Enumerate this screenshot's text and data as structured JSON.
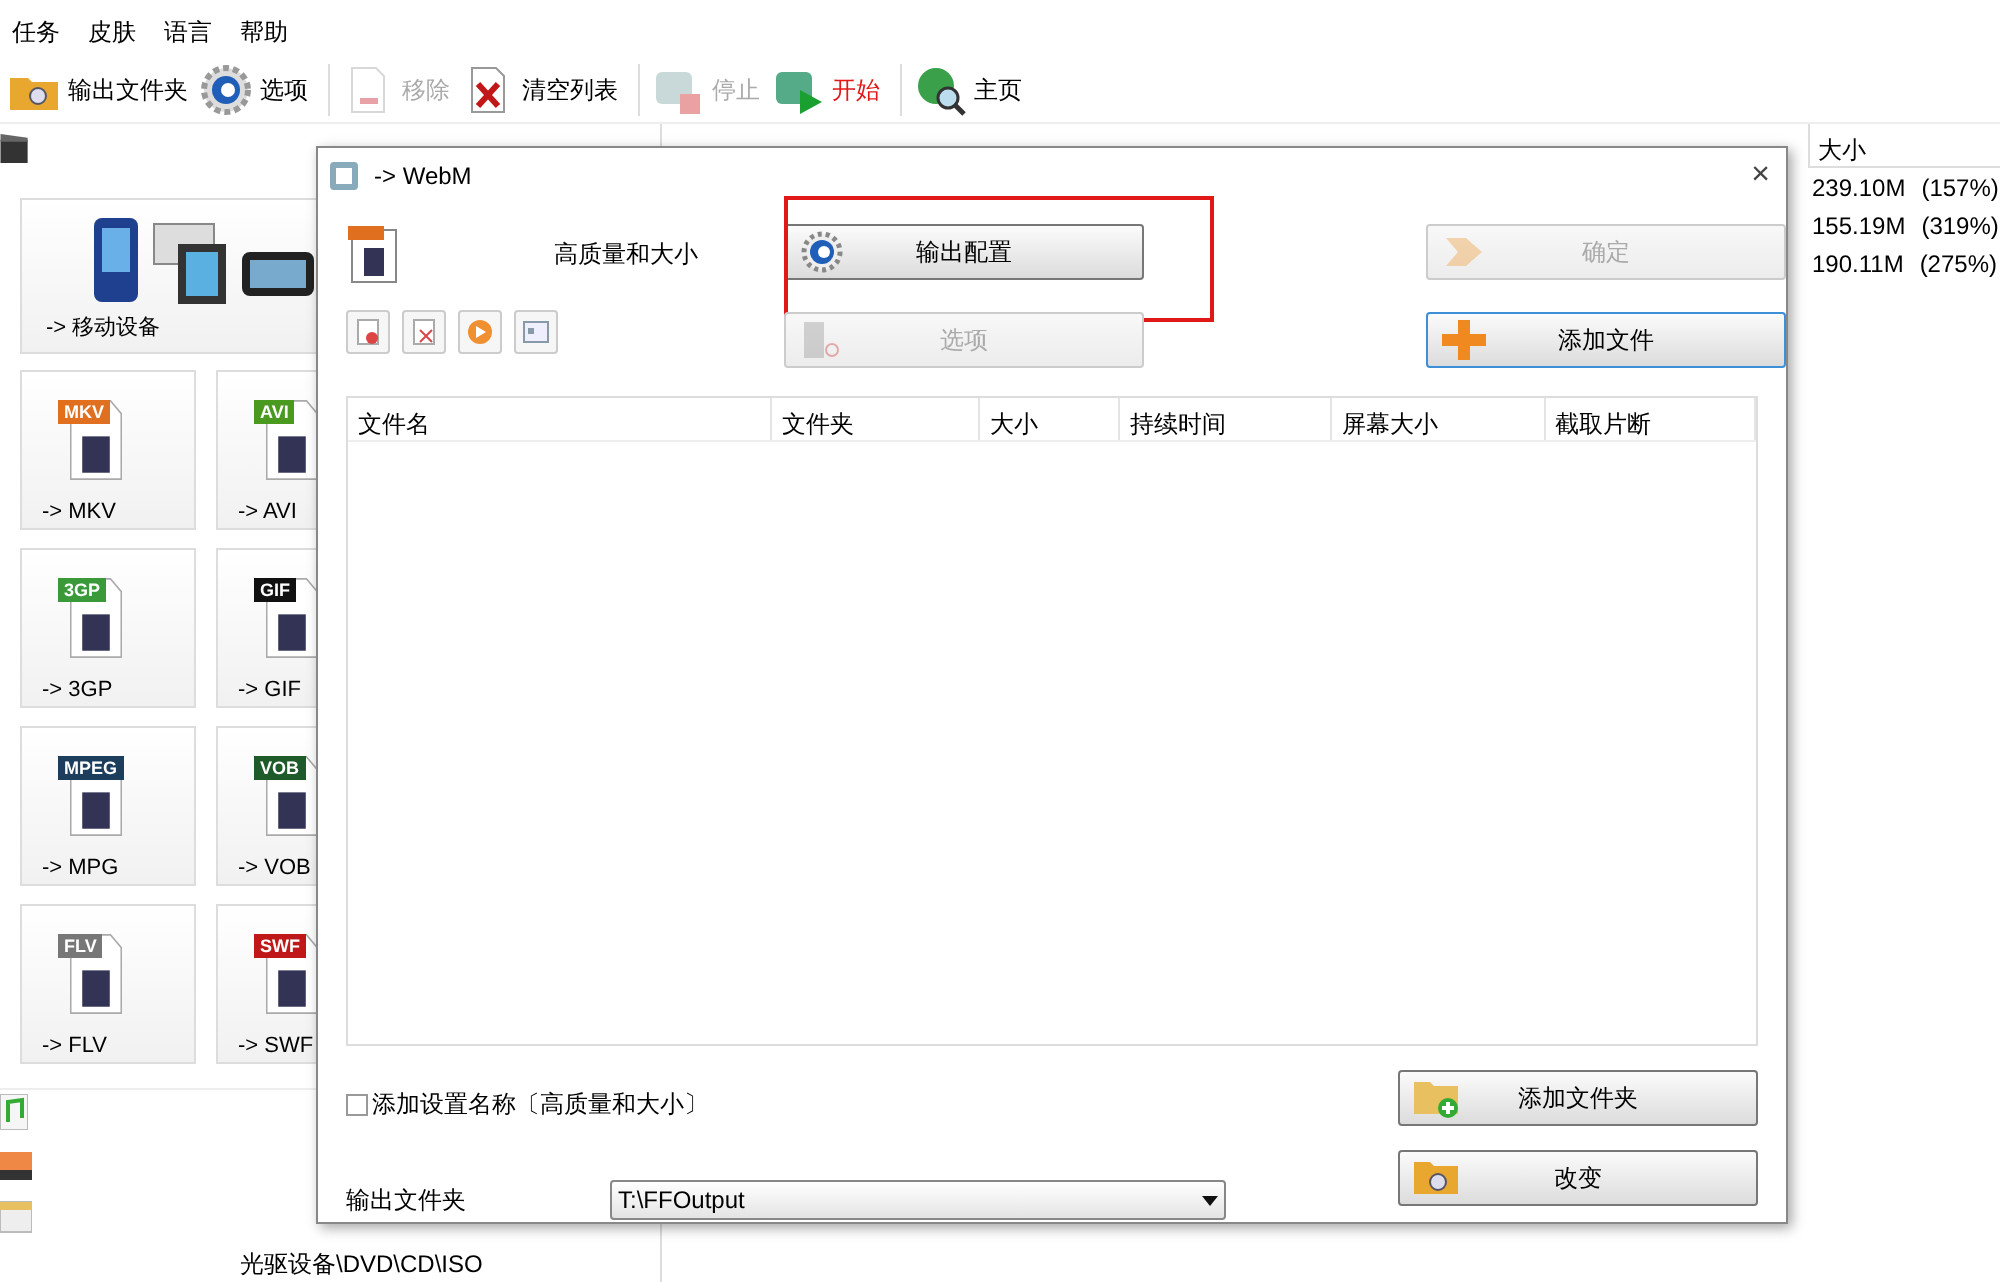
{
  "menu": [
    "任务",
    "皮肤",
    "语言",
    "帮助"
  ],
  "toolbar": [
    {
      "label": "输出文件夹",
      "kind": "folder",
      "disabled": false,
      "emphasized": false
    },
    {
      "label": "选项",
      "kind": "gear",
      "disabled": false,
      "emphasized": false
    },
    {
      "label": "移除",
      "kind": "remove",
      "disabled": true,
      "emphasized": false
    },
    {
      "label": "清空列表",
      "kind": "clear",
      "disabled": false,
      "emphasized": false
    },
    {
      "label": "停止",
      "kind": "stop",
      "disabled": true,
      "emphasized": false
    },
    {
      "label": "开始",
      "kind": "start",
      "disabled": false,
      "emphasized": true
    },
    {
      "label": "主页",
      "kind": "home",
      "disabled": false,
      "emphasized": false
    }
  ],
  "left_panel": {
    "big_tile": {
      "label": "-> 移动设备"
    },
    "tiles": [
      {
        "label": "-> MKV",
        "tag": "MKV",
        "color": "#e07020"
      },
      {
        "label": "-> AVI",
        "tag": "AVI",
        "color": "#4a9a20"
      },
      {
        "label": "-> 3GP",
        "tag": "3GP",
        "color": "#3a9a3a"
      },
      {
        "label": "-> GIF",
        "tag": "GIF",
        "color": "#111111"
      },
      {
        "label": "-> MPG",
        "tag": "MPEG",
        "color": "#1d3d5c"
      },
      {
        "label": "-> VOB",
        "tag": "VOB",
        "color": "#1f5a2a"
      },
      {
        "label": "-> FLV",
        "tag": "FLV",
        "color": "#777777"
      },
      {
        "label": "-> SWF",
        "tag": "SWF",
        "color": "#c01818"
      }
    ],
    "bottom_label": "光驱设备\\DVD\\CD\\ISO"
  },
  "file_table": {
    "column": "大小",
    "rows": [
      {
        "size": "239.10M",
        "ratio": "(157%)"
      },
      {
        "size": "155.19M",
        "ratio": "(319%)"
      },
      {
        "size": "190.11M",
        "ratio": "(275%)"
      }
    ]
  },
  "dialog": {
    "title": "-> WebM",
    "close": "×",
    "profile": "高质量和大小",
    "buttons": [
      {
        "label": "输出配置",
        "kind": "gear",
        "disabled": false,
        "highlighted": true
      },
      {
        "label": "确定",
        "kind": "arrow",
        "disabled": true,
        "highlighted": false
      },
      {
        "label": "选项",
        "kind": "film",
        "disabled": true,
        "highlighted": false
      },
      {
        "label": "添加文件",
        "kind": "plus",
        "disabled": false,
        "highlighted": false
      }
    ],
    "columns": [
      "文件名",
      "文件夹",
      "大小",
      "持续时间",
      "屏幕大小",
      "截取片断"
    ],
    "checkbox": {
      "label": "添加设置名称〔高质量和大小〕",
      "checked": false
    },
    "output_folder": {
      "label": "输出文件夹",
      "value": "T:\\FFOutput"
    },
    "bottom_buttons": [
      {
        "label": "添加文件夹",
        "kind": "folder-add"
      },
      {
        "label": "改变",
        "kind": "folder"
      }
    ]
  }
}
